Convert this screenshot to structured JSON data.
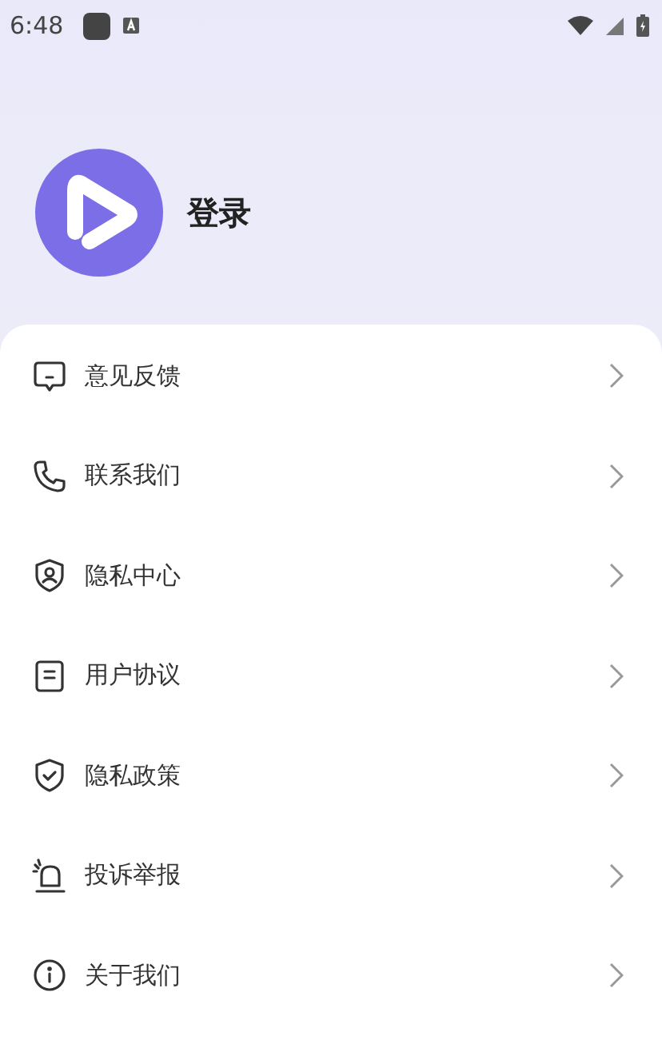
{
  "status_bar": {
    "time": "6:48"
  },
  "profile": {
    "login_label": "登录"
  },
  "menu": [
    {
      "kind": "feedback",
      "label": "意见反馈"
    },
    {
      "kind": "phone",
      "label": "联系我们"
    },
    {
      "kind": "privacy",
      "label": "隐私中心"
    },
    {
      "kind": "document",
      "label": "用户协议"
    },
    {
      "kind": "shield",
      "label": "隐私政策"
    },
    {
      "kind": "alarm",
      "label": "投诉举报"
    },
    {
      "kind": "info",
      "label": "关于我们"
    }
  ]
}
